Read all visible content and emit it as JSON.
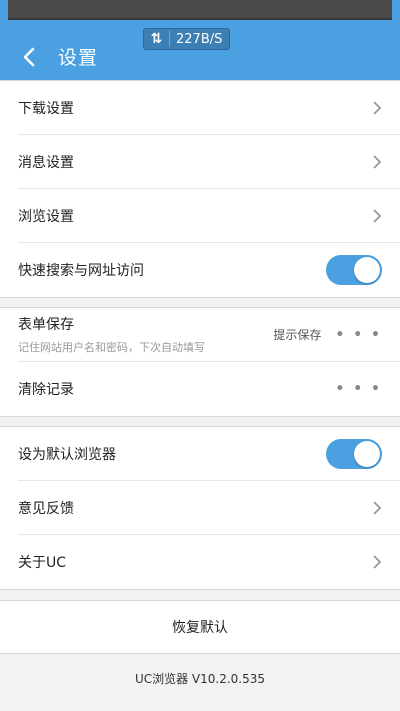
{
  "status": {
    "speed": "227B/S"
  },
  "header": {
    "title": "设置"
  },
  "group1": [
    {
      "label": "下载设置",
      "control": "chevron"
    },
    {
      "label": "消息设置",
      "control": "chevron"
    },
    {
      "label": "浏览设置",
      "control": "chevron"
    },
    {
      "label": "快速搜索与网址访问",
      "control": "toggle",
      "on": true
    }
  ],
  "group2": {
    "form_save": {
      "label": "表单保存",
      "sub": "记住网站用户名和密码，下次自动填写",
      "value": "提示保存"
    },
    "clear": {
      "label": "清除记录"
    }
  },
  "group3": [
    {
      "label": "设为默认浏览器",
      "control": "toggle",
      "on": true
    },
    {
      "label": "意见反馈",
      "control": "chevron"
    },
    {
      "label": "关于UC",
      "control": "chevron"
    }
  ],
  "more_label": "• • •",
  "reset_label": "恢复默认",
  "version": "UC浏览器 V10.2.0.535",
  "colors": {
    "accent": "#4aa0e0"
  }
}
